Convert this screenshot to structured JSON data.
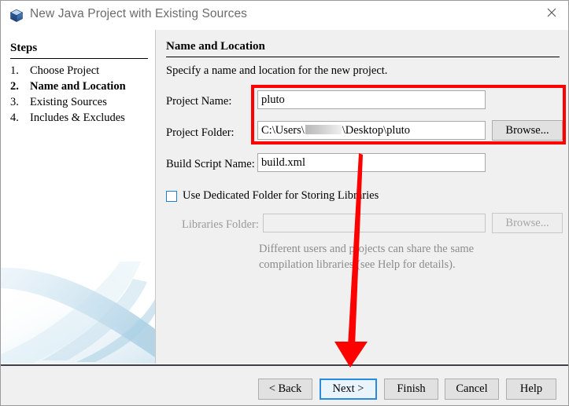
{
  "window": {
    "title": "New Java Project with Existing Sources",
    "icon": "cube-icon",
    "close_label": "×"
  },
  "sidebar": {
    "heading": "Steps",
    "steps": [
      {
        "num": "1.",
        "label": "Choose Project",
        "current": false
      },
      {
        "num": "2.",
        "label": "Name and Location",
        "current": true
      },
      {
        "num": "3.",
        "label": "Existing Sources",
        "current": false
      },
      {
        "num": "4.",
        "label": "Includes & Excludes",
        "current": false
      }
    ]
  },
  "main": {
    "title": "Name and Location",
    "description": "Specify a name and location for the new project.",
    "fields": {
      "project_name": {
        "label": "Project Name:",
        "value": "pluto",
        "placeholder": ""
      },
      "project_folder": {
        "label": "Project Folder:",
        "value_prefix": "C:\\Users\\",
        "value_redacted": "",
        "value_suffix": "\\Desktop\\pluto",
        "browse_label": "Browse..."
      },
      "build_script_name": {
        "label": "Build Script Name:",
        "value": "build.xml",
        "placeholder": ""
      },
      "use_dedicated_folder": {
        "label": "Use Dedicated Folder for Storing Libraries",
        "checked": false
      },
      "libraries_folder": {
        "label": "Libraries Folder:",
        "value": "",
        "placeholder": "",
        "browse_label": "Browse...",
        "disabled": true
      }
    },
    "hint_line1": "Different users and projects can share the same",
    "hint_line2": "compilation libraries (see Help for details)."
  },
  "buttons": {
    "back": "< Back",
    "next": "Next >",
    "finish": "Finish",
    "cancel": "Cancel",
    "help": "Help"
  },
  "annotations": {
    "highlight_color": "#ff0000",
    "arrow_color": "#ff0000"
  },
  "colors": {
    "panel_bg": "#f0f0f0",
    "sidebar_bg": "#ffffff",
    "focus_blue": "#2a8ade",
    "checkbox_blue": "#1a7fd4",
    "disabled_text": "#9a9a9a"
  }
}
